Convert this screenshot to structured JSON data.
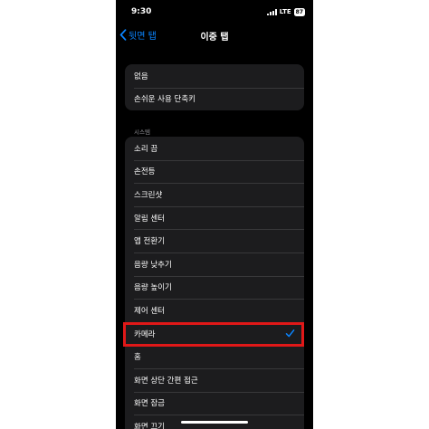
{
  "status_bar": {
    "time": "9:30",
    "network": "LTE",
    "battery": "87"
  },
  "nav": {
    "back_label": "뒷면 탭",
    "title": "이중 탭"
  },
  "group1": {
    "items": [
      {
        "label": "없음"
      },
      {
        "label": "손쉬운 사용 단축키"
      }
    ]
  },
  "section": {
    "label": "시스템"
  },
  "group2": {
    "items": [
      {
        "label": "소리 끔"
      },
      {
        "label": "손전등"
      },
      {
        "label": "스크린샷"
      },
      {
        "label": "알림 센터"
      },
      {
        "label": "앱 전환기"
      },
      {
        "label": "음량 낮추기"
      },
      {
        "label": "음량 높이기"
      },
      {
        "label": "제어 센터"
      },
      {
        "label": "카메라",
        "selected": true
      },
      {
        "label": "홈"
      },
      {
        "label": "화면 상단 간편 접근"
      },
      {
        "label": "화면 잠금"
      },
      {
        "label": "화면 끄기"
      }
    ]
  },
  "colors": {
    "accent": "#0a84ff",
    "highlight": "#e01818",
    "cell": "#1c1c1e",
    "background": "#000000"
  }
}
